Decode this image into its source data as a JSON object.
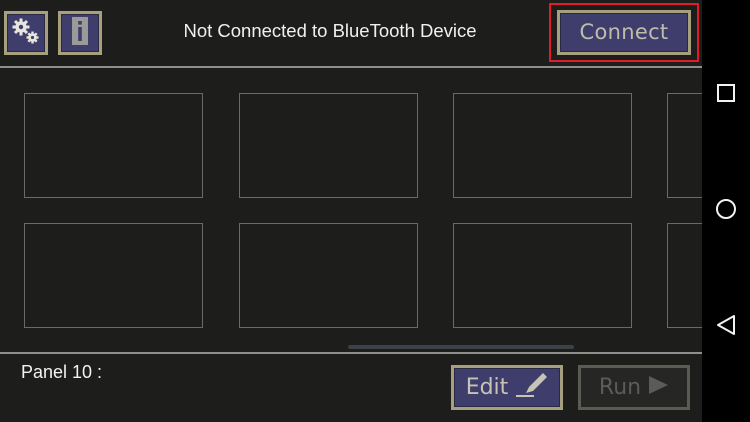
{
  "header": {
    "settings_icon": "gears-icon",
    "info_icon": "info-icon",
    "status_text": "Not Connected to BlueTooth Device",
    "connect_label": "Connect",
    "highlight_color": "#e01b2a"
  },
  "panel_grid": {
    "rows": 2,
    "columns_visible": 4,
    "tiles": [
      "",
      "",
      "",
      "",
      "",
      "",
      "",
      ""
    ]
  },
  "footer": {
    "panel_label": "Panel 10 :",
    "edit_label": "Edit",
    "edit_icon": "pencil-icon",
    "run_label": "Run",
    "run_icon": "play-icon",
    "run_enabled": false
  },
  "android_nav": {
    "recent_icon": "square-icon",
    "home_icon": "circle-icon",
    "back_icon": "triangle-back-icon"
  },
  "colors": {
    "app_background": "#1d1e1c",
    "button_fill": "#3e3d6c",
    "button_border": "#a6a07e"
  }
}
